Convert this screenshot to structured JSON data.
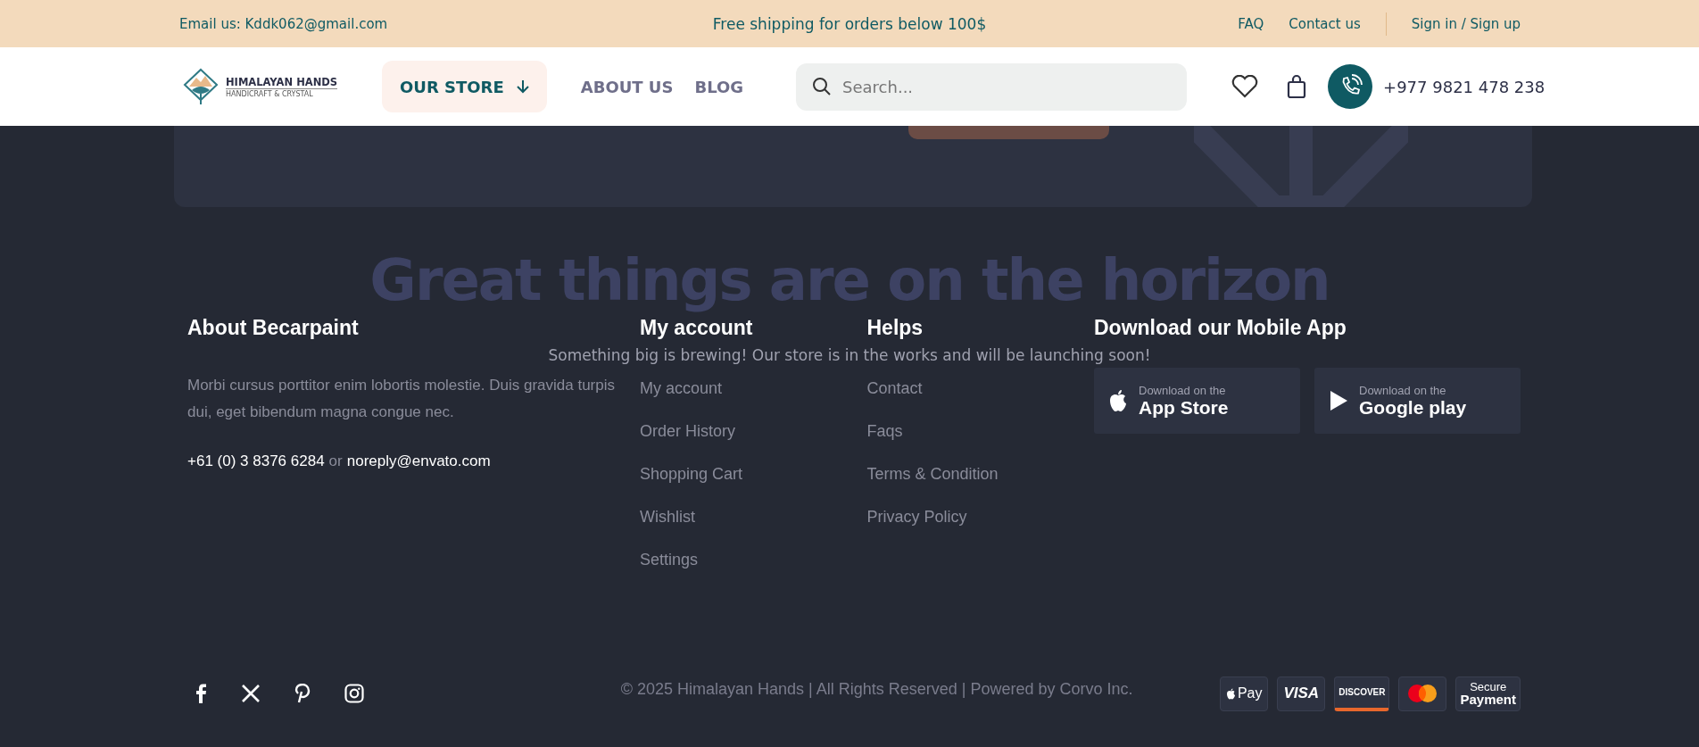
{
  "top_bar": {
    "email": "Email us: Kddk062@gmail.com",
    "promo": "Free shipping for orders below 100$",
    "links": [
      "FAQ",
      "Contact us"
    ],
    "auth": "Sign in / Sign up"
  },
  "header": {
    "logo": {
      "title": "HIMALAYAN HANDS",
      "subtitle": "HANDICRAFT & CRYSTAL"
    },
    "store_button": "OUR STORE",
    "nav": [
      "ABOUT US",
      "BLOG"
    ],
    "search": {
      "placeholder": "Search..."
    },
    "phone": "+977 9821 478 238"
  },
  "hero": {
    "heading": "Great things are on the horizon",
    "subtitle": "Something big is brewing! Our store is in the works and will be launching soon!"
  },
  "footer": {
    "about": {
      "heading": "About Becarpaint",
      "text": "Morbi cursus porttitor enim lobortis molestie. Duis gravida turpis dui, eget bibendum magna congue nec.",
      "phone": "+61 (0) 3 8376 6284",
      "or": "or",
      "email": "noreply@envato.com"
    },
    "columns": [
      {
        "heading": "My account",
        "links": [
          "My account",
          "Order History",
          "Shopping Cart",
          "Wishlist",
          "Settings"
        ]
      },
      {
        "heading": "Helps",
        "links": [
          "Contact",
          "Faqs",
          "Terms & Condition",
          "Privacy Policy"
        ]
      }
    ],
    "apps": {
      "heading": "Download our Mobile App",
      "buttons": [
        {
          "kind": "apple",
          "caption": "Download on the",
          "label": "App Store"
        },
        {
          "kind": "google",
          "caption": "Download on the",
          "label": "Google play"
        }
      ]
    }
  },
  "bottom": {
    "socials": [
      {
        "kind": "facebook"
      },
      {
        "kind": "x"
      },
      {
        "kind": "pinterest"
      },
      {
        "kind": "instagram"
      }
    ],
    "copyright": "© 2025 Himalayan Hands | All Rights Reserved | Powered by Corvo Inc.",
    "payments": [
      {
        "kind": "applepay",
        "label": "Pay"
      },
      {
        "kind": "visa",
        "label": "VISA"
      },
      {
        "kind": "discover",
        "label": "DISCOVER"
      },
      {
        "kind": "mastercard"
      },
      {
        "kind": "secure",
        "label": "Secure",
        "sublabel": "Payment"
      }
    ]
  }
}
